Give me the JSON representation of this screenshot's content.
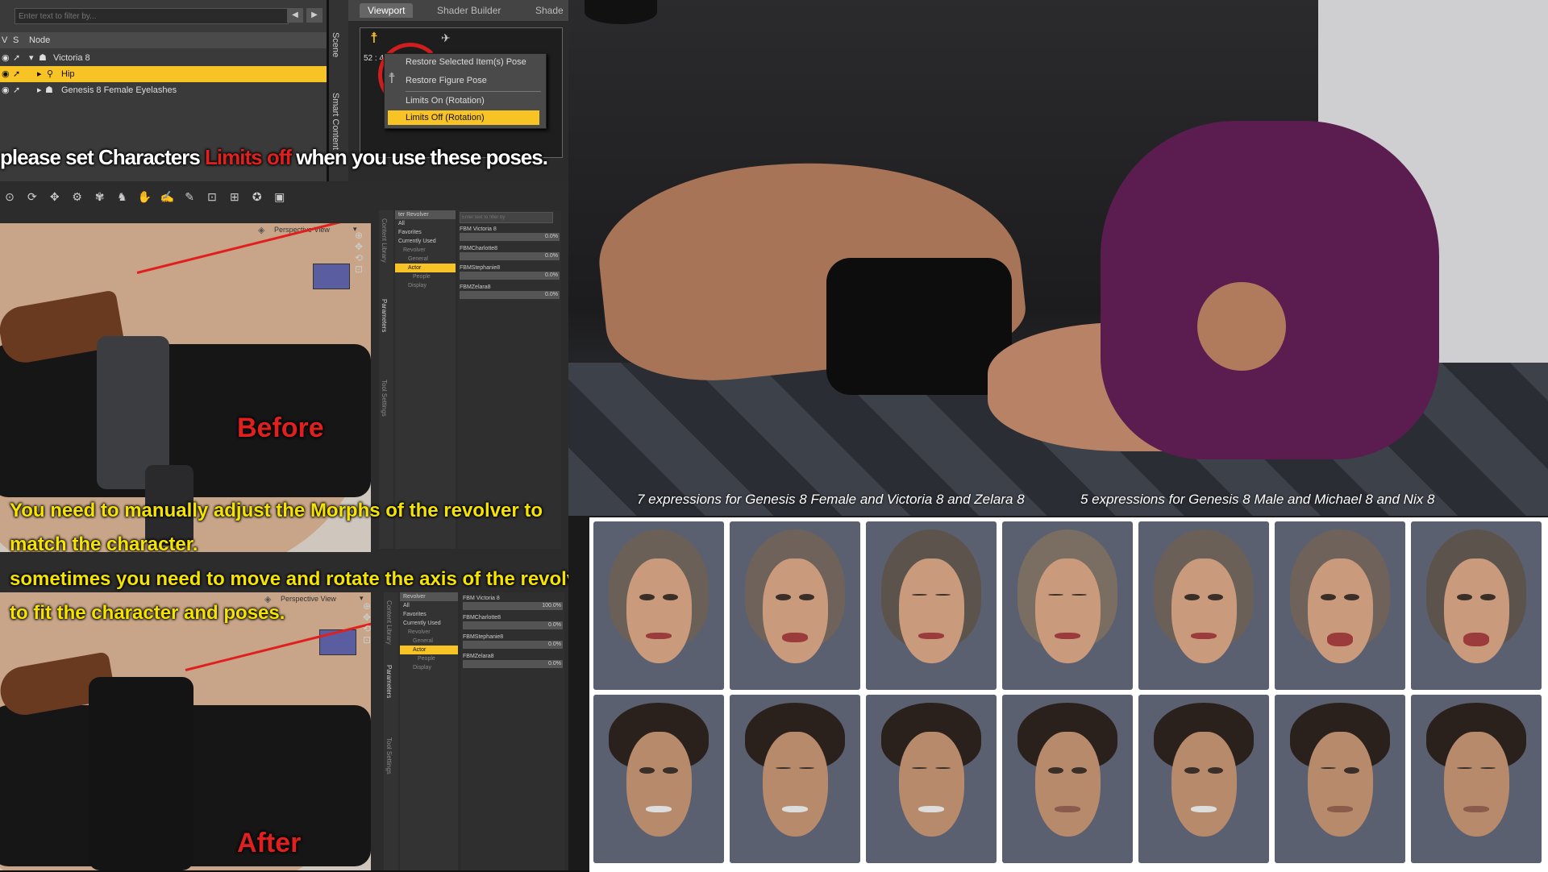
{
  "scene_panel": {
    "filter_placeholder": "Enter text to filter by...",
    "col_v": "V",
    "col_s": "S",
    "col_node": "Node",
    "tabs": [
      "Scene",
      "Smart Content"
    ],
    "rows": [
      {
        "label": "Victoria 8",
        "selected": false
      },
      {
        "label": "Hip",
        "selected": true
      },
      {
        "label": "Genesis 8 Female Eyelashes",
        "selected": false
      }
    ]
  },
  "viewport_tabs": [
    "Viewport",
    "Shader Builder",
    "Shade"
  ],
  "viewport_readout": "52 : 4",
  "context_menu": {
    "items": [
      {
        "label": "Restore Selected Item(s) Pose",
        "highlighted": false
      },
      {
        "label": "Restore Figure Pose",
        "highlighted": false
      },
      {
        "label": "Limits On (Rotation)",
        "highlighted": false
      },
      {
        "label": "Limits Off (Rotation)",
        "highlighted": true
      }
    ]
  },
  "notice": {
    "prefix": "please set Characters ",
    "highlight": "Limits off",
    "suffix": " when you use these poses."
  },
  "before_panel": {
    "view_label": "Perspective View",
    "overlay_label": "Before",
    "param_filter_placeholder": "Enter text to filter by",
    "param_tree_header": "ter  Revolver",
    "param_tree": [
      "All",
      "Favorites",
      "Currently Used",
      "Revolver",
      "General",
      "Actor",
      "People",
      "Display"
    ],
    "morphs": [
      {
        "label": "FBM Victoria 8",
        "value": "0.0%",
        "fill": 0.0
      },
      {
        "label": "FBMCharlotte8",
        "value": "0.0%",
        "fill": 0.0
      },
      {
        "label": "FBMStephanie8",
        "value": "0.0%",
        "fill": 0.0
      },
      {
        "label": "FBMZelara8",
        "value": "0.0%",
        "fill": 0.0
      }
    ],
    "side_tabs": [
      "Content Library",
      "Parameters",
      "Tool Settings"
    ]
  },
  "after_panel": {
    "view_label": "Perspective View",
    "overlay_label": "After",
    "param_tree_header": "Revolver",
    "param_tree": [
      "All",
      "Favorites",
      "Currently Used",
      "Revolver",
      "General",
      "Actor",
      "People",
      "Display"
    ],
    "morphs": [
      {
        "label": "FBM Victoria 8",
        "value": "100.0%",
        "fill": 1.0
      },
      {
        "label": "FBMCharlotte8",
        "value": "0.0%",
        "fill": 0.0
      },
      {
        "label": "FBMStephanie8",
        "value": "0.0%",
        "fill": 0.0
      },
      {
        "label": "FBMZelara8",
        "value": "0.0%",
        "fill": 0.0
      }
    ],
    "side_tabs": [
      "Content Library",
      "Parameters",
      "Tool Settings"
    ]
  },
  "instructions": {
    "line1": "You need to manually adjust the Morphs of the revolver to",
    "line2": "match the character.",
    "line3": "sometimes you need to move and rotate the axis of the revolver",
    "line4": "to fit the character and poses."
  },
  "captions": {
    "female": "7 expressions for Genesis 8 Female and Victoria 8 and Zelara 8",
    "male": "5 expressions for Genesis 8 Male and Michael 8 and Nix 8"
  },
  "expressions": {
    "female_count": 7,
    "male_count": 7
  },
  "colors": {
    "selection": "#f7c325",
    "red_accent": "#e0201e",
    "yellow_text": "#f5e400",
    "panel_bg": "#3b3b3b"
  }
}
